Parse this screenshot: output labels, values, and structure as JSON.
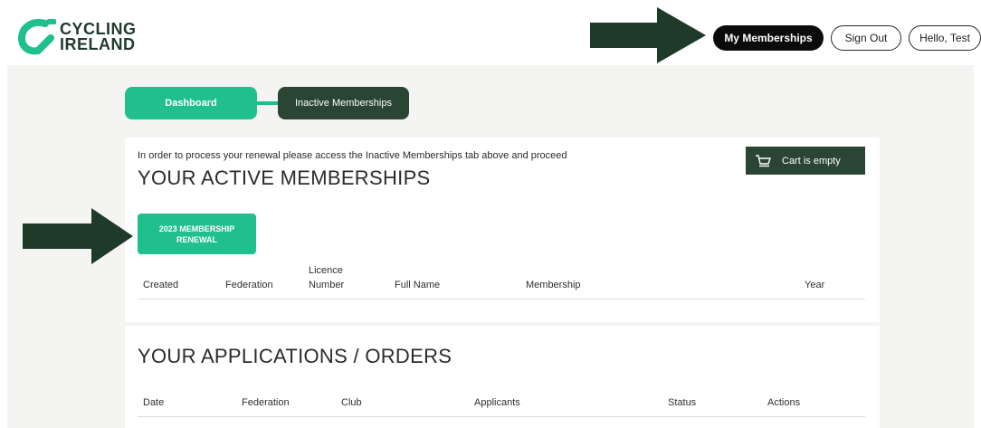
{
  "brand": {
    "line1": "CYCLING",
    "line2": "IRELAND",
    "color": "#1fc08e"
  },
  "nav": {
    "my_memberships": "My Memberships",
    "sign_out": "Sign Out",
    "hello": "Hello, Test"
  },
  "tabs": {
    "dashboard": "Dashboard",
    "inactive": "Inactive Memberships"
  },
  "notice": "In order to process your renewal please access the Inactive Memberships tab above and proceed",
  "active": {
    "title": "YOUR ACTIVE MEMBERSHIPS",
    "cart": "Cart is empty",
    "renew_button": "2023 MEMBERSHIP RENEWAL",
    "columns": {
      "created": "Created",
      "federation": "Federation",
      "licence_1": "Licence",
      "licence_2": "Number",
      "full_name": "Full Name",
      "membership": "Membership",
      "year": "Year"
    }
  },
  "orders": {
    "title": "YOUR APPLICATIONS / ORDERS",
    "columns": {
      "date": "Date",
      "federation": "Federation",
      "club": "Club",
      "applicants": "Applicants",
      "status": "Status",
      "actions": "Actions"
    }
  },
  "colors": {
    "accent": "#1fc08e",
    "dark_green": "#2a4533",
    "arrow": "#1e3a28"
  },
  "icons": [
    "logo-icon",
    "cart-icon",
    "arrow-icon"
  ]
}
